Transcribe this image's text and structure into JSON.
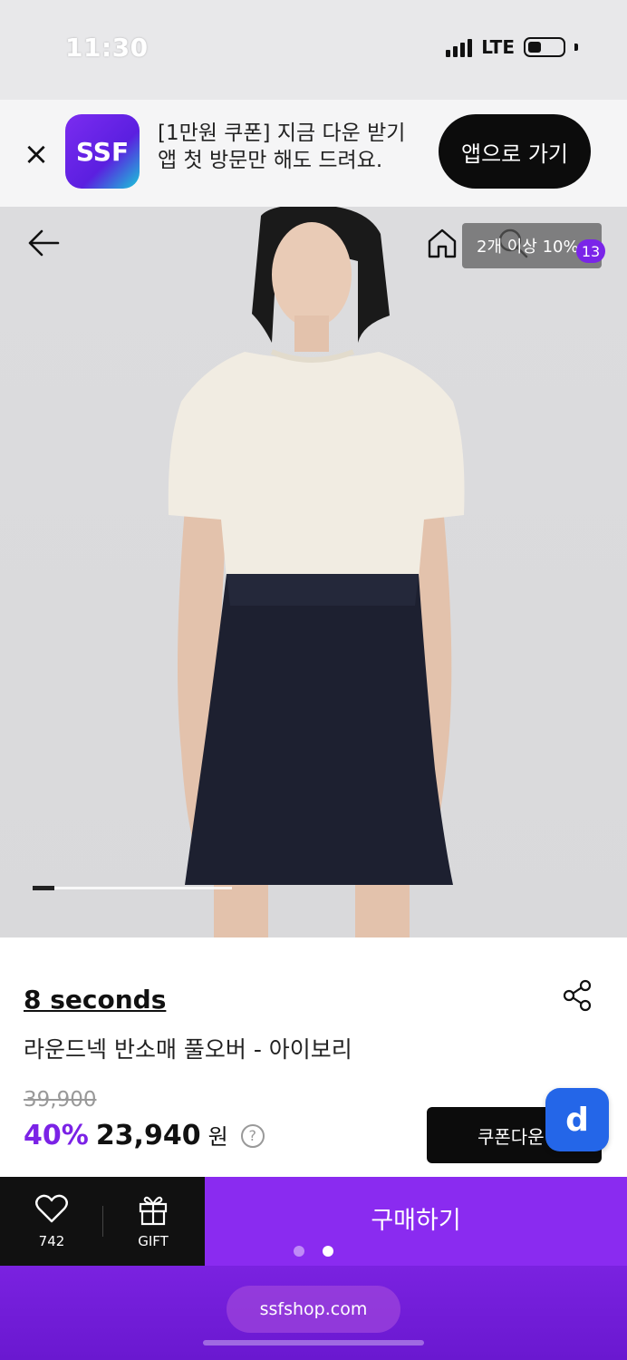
{
  "status_bar": {
    "time": "11:30",
    "network": "LTE"
  },
  "app_banner": {
    "logo_text": "SSF",
    "line1": "[1만원 쿠폰] 지금 다운 받기",
    "line2": "앱 첫 방문만 해도 드려요.",
    "cta_label": "앱으로 가기"
  },
  "header": {
    "tooltip": "2개 이상 10%",
    "cart_count": "13"
  },
  "carousel": {
    "current_fraction": 0.1
  },
  "product": {
    "brand": "8 seconds",
    "name": "라운드넥 반소매 풀오버 - 아이보리",
    "original_price": "39,900",
    "discount": "40%",
    "sale_price": "23,940",
    "currency": "원",
    "help_glyph": "?",
    "coupon_label": "쿠폰다운",
    "badge_letter": "d"
  },
  "bottom_bar": {
    "like_count": "742",
    "gift_label": "GIFT",
    "buy_label": "구매하기"
  },
  "browser": {
    "url": "ssfshop.com",
    "page_dots": 2,
    "active_dot": 2
  },
  "colors": {
    "accent": "#8a2bf0",
    "discount": "#7b22e6",
    "badge_blue": "#2466e8"
  },
  "icons": [
    "close-icon",
    "back-arrow-icon",
    "home-icon",
    "search-icon",
    "shopping-bag-icon",
    "share-icon",
    "heart-icon",
    "gift-icon",
    "help-icon"
  ]
}
